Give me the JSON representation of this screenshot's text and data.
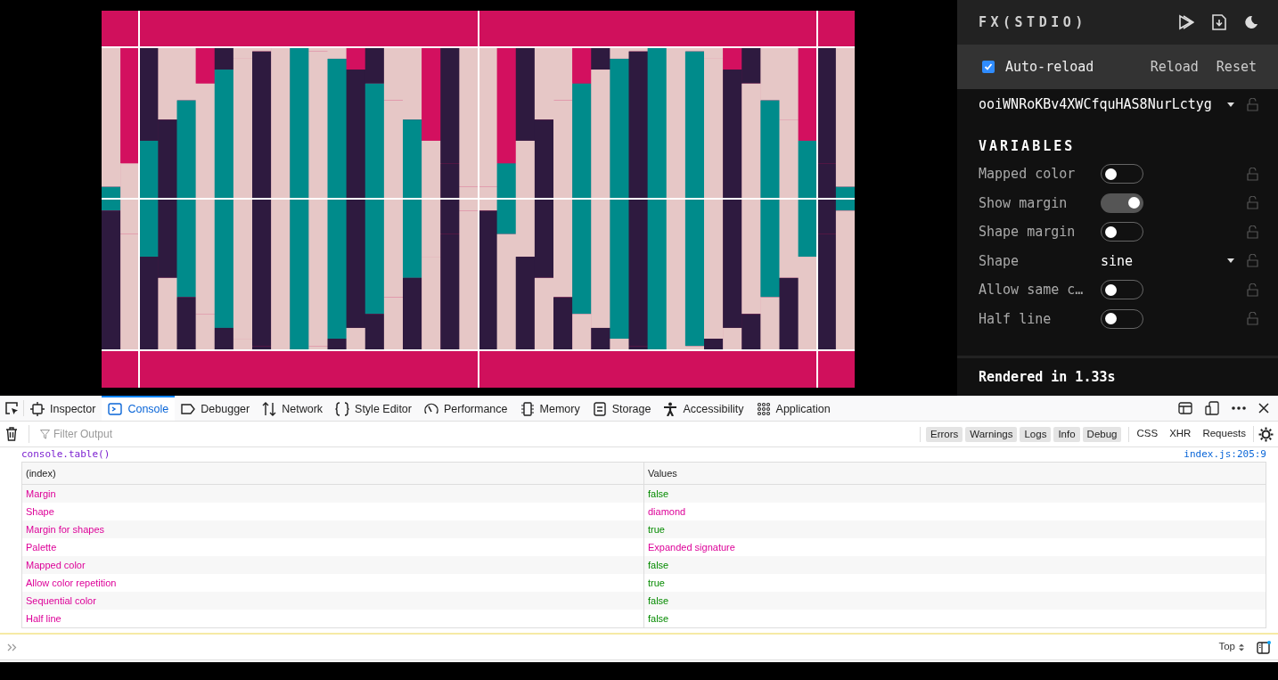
{
  "studio": {
    "logo": "FX(STDIO)",
    "auto_reload": {
      "label": "Auto-reload",
      "checked": true
    },
    "buttons": [
      "Reload",
      "Reset"
    ],
    "seed": "ooiWNRoKBv4XWCfquHAS8NurLctyg",
    "section_title": "VARIABLES",
    "variables": [
      {
        "label": "Mapped color",
        "kind": "toggle",
        "on": false
      },
      {
        "label": "Show margin",
        "kind": "toggle",
        "on": true
      },
      {
        "label": "Shape margin",
        "kind": "toggle",
        "on": false
      },
      {
        "label": "Shape",
        "kind": "select",
        "value": "sine"
      },
      {
        "label": "Allow same c…",
        "kind": "toggle",
        "on": false
      },
      {
        "label": "Half line",
        "kind": "toggle",
        "on": false
      }
    ],
    "status": "Rendered in 1.33s"
  },
  "devtools": {
    "tabs": [
      {
        "label": "Inspector",
        "selected": false
      },
      {
        "label": "Console",
        "selected": true
      },
      {
        "label": "Debugger",
        "selected": false
      },
      {
        "label": "Network",
        "selected": false
      },
      {
        "label": "Style Editor",
        "selected": false
      },
      {
        "label": "Performance",
        "selected": false
      },
      {
        "label": "Memory",
        "selected": false
      },
      {
        "label": "Storage",
        "selected": false
      },
      {
        "label": "Accessibility",
        "selected": false
      },
      {
        "label": "Application",
        "selected": false
      }
    ],
    "filter": {
      "placeholder": "Filter Output"
    },
    "level_filters": [
      "Errors",
      "Warnings",
      "Logs",
      "Info",
      "Debug"
    ],
    "type_filters": [
      "CSS",
      "XHR",
      "Requests"
    ],
    "log": {
      "call": "console.table()",
      "source": "index.js:205:9",
      "columns": [
        "(index)",
        "Values"
      ],
      "rows": [
        {
          "index": "Margin",
          "value": "false",
          "kind": "boolean"
        },
        {
          "index": "Shape",
          "value": "diamond",
          "kind": "string"
        },
        {
          "index": "Margin for shapes",
          "value": "true",
          "kind": "boolean"
        },
        {
          "index": "Palette",
          "value": "Expanded signature",
          "kind": "string"
        },
        {
          "index": "Mapped color",
          "value": "false",
          "kind": "boolean"
        },
        {
          "index": "Allow color repetition",
          "value": "true",
          "kind": "boolean"
        },
        {
          "index": "Sequential color",
          "value": "false",
          "kind": "boolean"
        },
        {
          "index": "Half line",
          "value": "false",
          "kind": "boolean"
        }
      ]
    },
    "context": "Top"
  }
}
